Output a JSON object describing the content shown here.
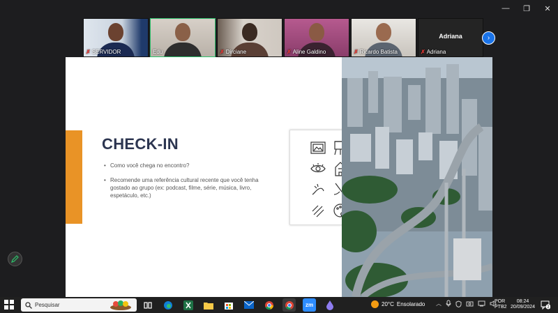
{
  "window": {
    "minimize_icon": "minimize-icon",
    "maximize_icon": "maximize-icon",
    "close_icon": "close-icon",
    "minimize": "—",
    "maximize": "❐",
    "close": "✕"
  },
  "participants": [
    {
      "name": "SERVIDOR",
      "muted": true,
      "kind": "video"
    },
    {
      "name": "Edu",
      "muted": false,
      "kind": "video",
      "active": true
    },
    {
      "name": "Dirciane",
      "muted": true,
      "kind": "video"
    },
    {
      "name": "Aline Galdino",
      "muted": true,
      "kind": "video"
    },
    {
      "name": "Ricardo Batista",
      "muted": true,
      "kind": "video"
    },
    {
      "name": "Adriana",
      "label": "Adriana",
      "muted": true,
      "kind": "text"
    }
  ],
  "gallery_next": "›",
  "slide": {
    "title": "CHECK-IN",
    "bullets": [
      "Como você chega no encontro?",
      "Recomende uma referência cultural recente que você tenha gostado ao grupo (ex: podcast, filme, série, música, livro, espetáculo, etc.)"
    ],
    "accent_color": "#e99326",
    "title_color": "#2c3550"
  },
  "taskbar": {
    "search_placeholder": "Pesquisar",
    "weather_temp": "20°C",
    "weather_desc": "Ensolarado",
    "lang_line1": "POR",
    "lang_line2": "PTB2",
    "time": "08:24",
    "date": "20/09/2024",
    "notification_count": "2",
    "apps": [
      "task-view",
      "edge",
      "excel",
      "file-explorer",
      "store",
      "mail",
      "chrome",
      "chrome-profile",
      "zoom",
      "cloud-drive"
    ],
    "zoom_label": "zm"
  }
}
